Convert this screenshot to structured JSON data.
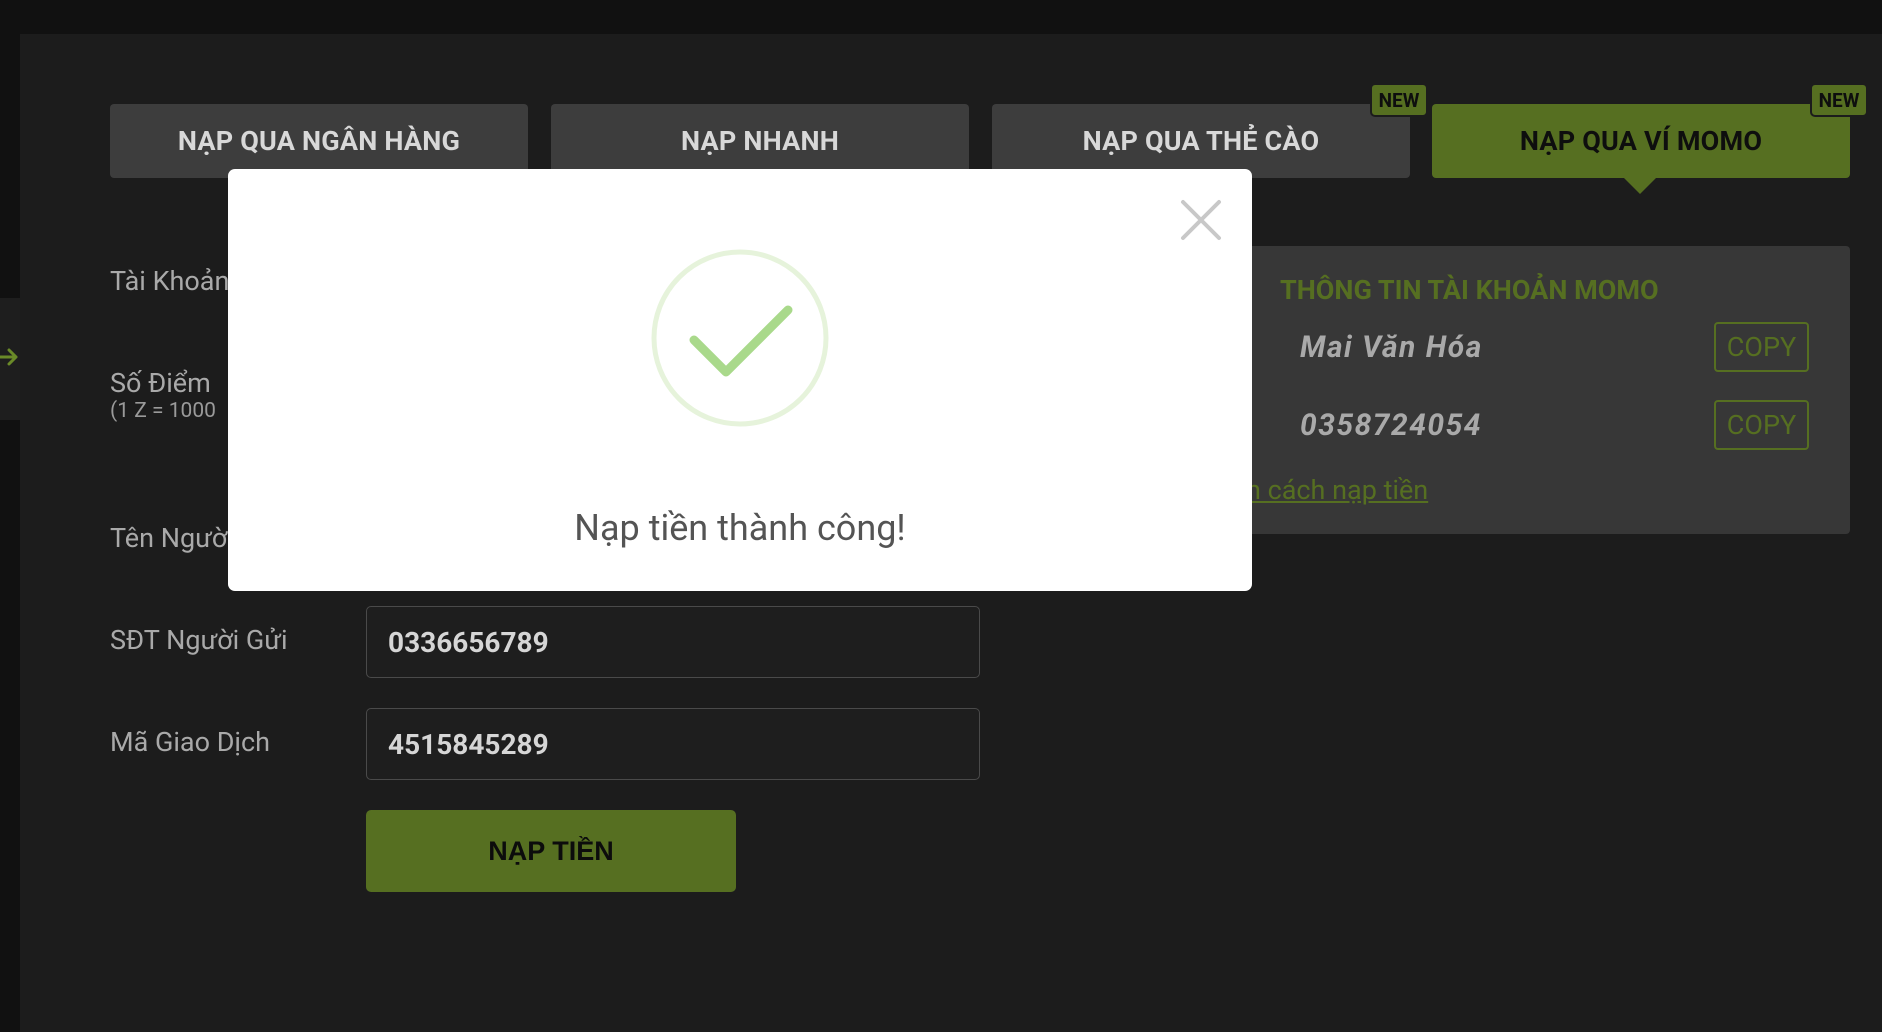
{
  "tabs": [
    {
      "label": "NẠP QUA NGÂN HÀNG",
      "active": false,
      "new": false
    },
    {
      "label": "NẠP NHANH",
      "active": false,
      "new": false
    },
    {
      "label": "NẠP QUA THẺ CÀO",
      "active": false,
      "new": true
    },
    {
      "label": "NẠP QUA VÍ MOMO",
      "active": true,
      "new": true
    }
  ],
  "new_badge": "NEW",
  "form": {
    "account_label": "Tài Khoản",
    "points_label": "Số Điểm",
    "points_note": "(1 Z = 1000",
    "sender_name_label": "Tên Người",
    "sender_phone_label": "SĐT Người Gửi",
    "sender_phone_value": "0336656789",
    "transaction_code_label": "Mã Giao Dịch",
    "transaction_code_value": "4515845289",
    "submit_label": "NẠP TIỀN"
  },
  "momo_info": {
    "title": "THÔNG TIN TÀI KHOẢN MOMO",
    "account_name": "Mai Văn Hóa",
    "account_phone": "0358724054",
    "copy_label": "COPY",
    "guide_link": "n cách nạp tiền",
    "partial_label": ":"
  },
  "modal": {
    "message": "Nạp tiền thành công!"
  },
  "colors": {
    "accent": "#566f21",
    "success_check": "#a9d98b",
    "success_ring": "#e6f3db",
    "background": "#1c1c1c"
  }
}
